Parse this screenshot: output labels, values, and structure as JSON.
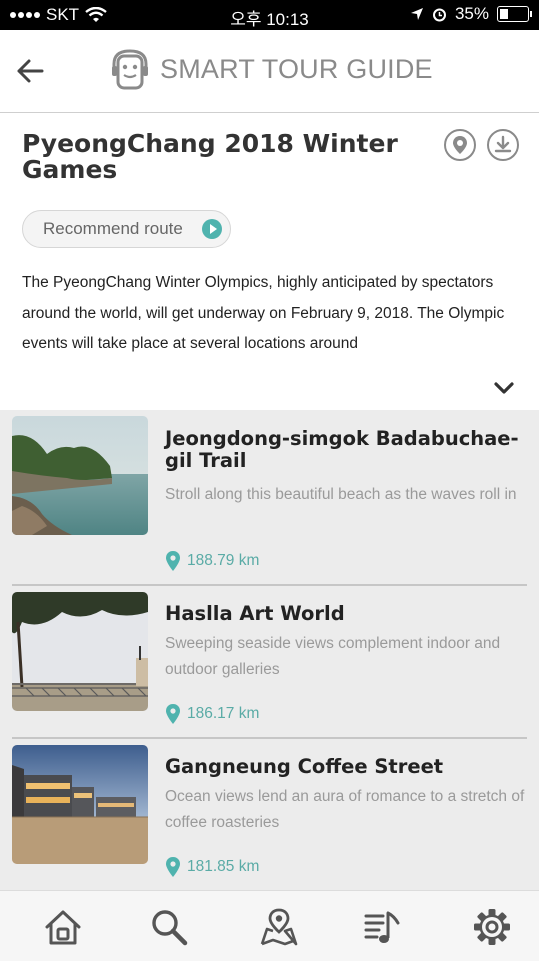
{
  "status_bar": {
    "carrier": "SKT",
    "time": "오후 10:13",
    "battery": "35%",
    "battery_level": 0.35
  },
  "header": {
    "app_title": "SMART TOUR GUIDE",
    "icons": [
      "back-arrow-icon",
      "robot-guide-logo"
    ]
  },
  "intro": {
    "title": "PyeongChang 2018 Winter Games",
    "route_button": "Recommend route",
    "description": "The PyeongChang Winter Olympics, highly anticipated by spectators around the world, will get underway on February 9, 2018. The Olympic events will take place at several locations around",
    "icons": [
      "location-pin-icon",
      "download-icon",
      "chevron-down-icon"
    ]
  },
  "places": [
    {
      "name": "Jeongdong-simgok Badabuchae-gil Trail",
      "summary": "Stroll along this beautiful beach as the waves roll in",
      "distance": "188.79 km"
    },
    {
      "name": "Haslla Art World",
      "summary": "Sweeping seaside views complement indoor and outdoor galleries",
      "distance": "186.17 km"
    },
    {
      "name": "Gangneung Coffee Street",
      "summary": "Ocean views lend an aura of romance to a stretch of coffee roasteries",
      "distance": "181.85 km"
    }
  ],
  "bottom_nav": {
    "icons": [
      "home-icon",
      "search-icon",
      "map-icon",
      "playlist-icon",
      "settings-icon"
    ]
  },
  "colors": {
    "accent": "#4fb3ae",
    "list_background": "#ececec"
  }
}
